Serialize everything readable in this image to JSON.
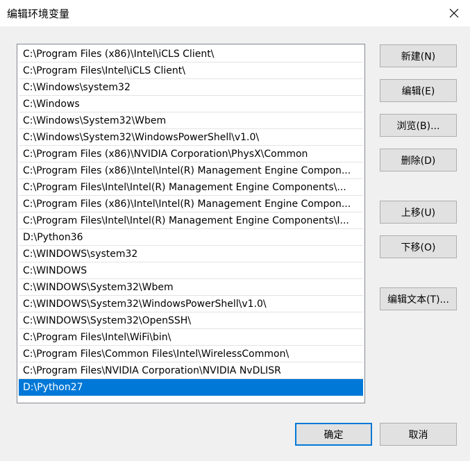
{
  "window": {
    "title": "编辑环境变量"
  },
  "paths": [
    {
      "value": "C:\\Program Files (x86)\\Intel\\iCLS Client\\",
      "selected": false
    },
    {
      "value": "C:\\Program Files\\Intel\\iCLS Client\\",
      "selected": false
    },
    {
      "value": "C:\\Windows\\system32",
      "selected": false
    },
    {
      "value": "C:\\Windows",
      "selected": false
    },
    {
      "value": "C:\\Windows\\System32\\Wbem",
      "selected": false
    },
    {
      "value": "C:\\Windows\\System32\\WindowsPowerShell\\v1.0\\",
      "selected": false
    },
    {
      "value": "C:\\Program Files (x86)\\NVIDIA Corporation\\PhysX\\Common",
      "selected": false
    },
    {
      "value": "C:\\Program Files (x86)\\Intel\\Intel(R) Management Engine Compon...",
      "selected": false
    },
    {
      "value": "C:\\Program Files\\Intel\\Intel(R) Management Engine Components\\...",
      "selected": false
    },
    {
      "value": "C:\\Program Files (x86)\\Intel\\Intel(R) Management Engine Compon...",
      "selected": false
    },
    {
      "value": "C:\\Program Files\\Intel\\Intel(R) Management Engine Components\\I...",
      "selected": false
    },
    {
      "value": "D:\\Python36",
      "selected": false
    },
    {
      "value": "C:\\WINDOWS\\system32",
      "selected": false
    },
    {
      "value": "C:\\WINDOWS",
      "selected": false
    },
    {
      "value": "C:\\WINDOWS\\System32\\Wbem",
      "selected": false
    },
    {
      "value": "C:\\WINDOWS\\System32\\WindowsPowerShell\\v1.0\\",
      "selected": false
    },
    {
      "value": "C:\\WINDOWS\\System32\\OpenSSH\\",
      "selected": false
    },
    {
      "value": "C:\\Program Files\\Intel\\WiFi\\bin\\",
      "selected": false
    },
    {
      "value": "C:\\Program Files\\Common Files\\Intel\\WirelessCommon\\",
      "selected": false
    },
    {
      "value": "C:\\Program Files\\NVIDIA Corporation\\NVIDIA NvDLISR",
      "selected": false
    },
    {
      "value": "D:\\Python27",
      "selected": true
    }
  ],
  "buttons": {
    "new": "新建(N)",
    "edit": "编辑(E)",
    "browse": "浏览(B)...",
    "delete": "删除(D)",
    "move_up": "上移(U)",
    "move_down": "下移(O)",
    "edit_text": "编辑文本(T)...",
    "ok": "确定",
    "cancel": "取消"
  },
  "colors": {
    "selection": "#0078d7",
    "default_button_border": "#0078d7"
  }
}
